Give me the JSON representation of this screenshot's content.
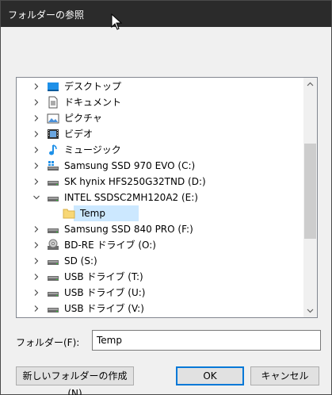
{
  "window": {
    "title": "フォルダーの参照"
  },
  "tree": {
    "items": [
      {
        "label": "デスクトップ",
        "icon": "desktop-icon",
        "expanded": false,
        "indent": 0
      },
      {
        "label": "ドキュメント",
        "icon": "documents-icon",
        "expanded": false,
        "indent": 0
      },
      {
        "label": "ピクチャ",
        "icon": "pictures-icon",
        "expanded": false,
        "indent": 0
      },
      {
        "label": "ビデオ",
        "icon": "video-icon",
        "expanded": false,
        "indent": 0
      },
      {
        "label": "ミュージック",
        "icon": "music-icon",
        "expanded": false,
        "indent": 0
      },
      {
        "label": "Samsung SSD 970 EVO (C:)",
        "icon": "system-drive-icon",
        "expanded": false,
        "indent": 0
      },
      {
        "label": "SK hynix HFS250G32TND (D:)",
        "icon": "drive-icon",
        "expanded": false,
        "indent": 0
      },
      {
        "label": "INTEL SSDSC2MH120A2 (E:)",
        "icon": "drive-icon",
        "expanded": true,
        "indent": 0
      },
      {
        "label": "Temp",
        "icon": "folder-icon",
        "expanded": null,
        "indent": 1,
        "selected": true
      },
      {
        "label": "Samsung SSD 840 PRO (F:)",
        "icon": "drive-icon",
        "expanded": false,
        "indent": 0
      },
      {
        "label": "BD-RE ドライブ (O:)",
        "icon": "optical-drive-icon",
        "expanded": false,
        "indent": 0
      },
      {
        "label": "SD (S:)",
        "icon": "drive-icon",
        "expanded": false,
        "indent": 0
      },
      {
        "label": "USB ドライブ (T:)",
        "icon": "drive-icon",
        "expanded": false,
        "indent": 0
      },
      {
        "label": "USB ドライブ (U:)",
        "icon": "drive-icon",
        "expanded": false,
        "indent": 0
      },
      {
        "label": "USB ドライブ (V:)",
        "icon": "drive-icon",
        "expanded": false,
        "indent": 0
      }
    ]
  },
  "folder": {
    "label": "フォルダー(F):",
    "value": "Temp"
  },
  "buttons": {
    "new_folder": "新しいフォルダーの作成(N)",
    "ok": "OK",
    "cancel": "キャンセル"
  },
  "colors": {
    "titlebar": "#2b2b2b",
    "selection": "#cce8ff",
    "accent": "#0078d7"
  }
}
